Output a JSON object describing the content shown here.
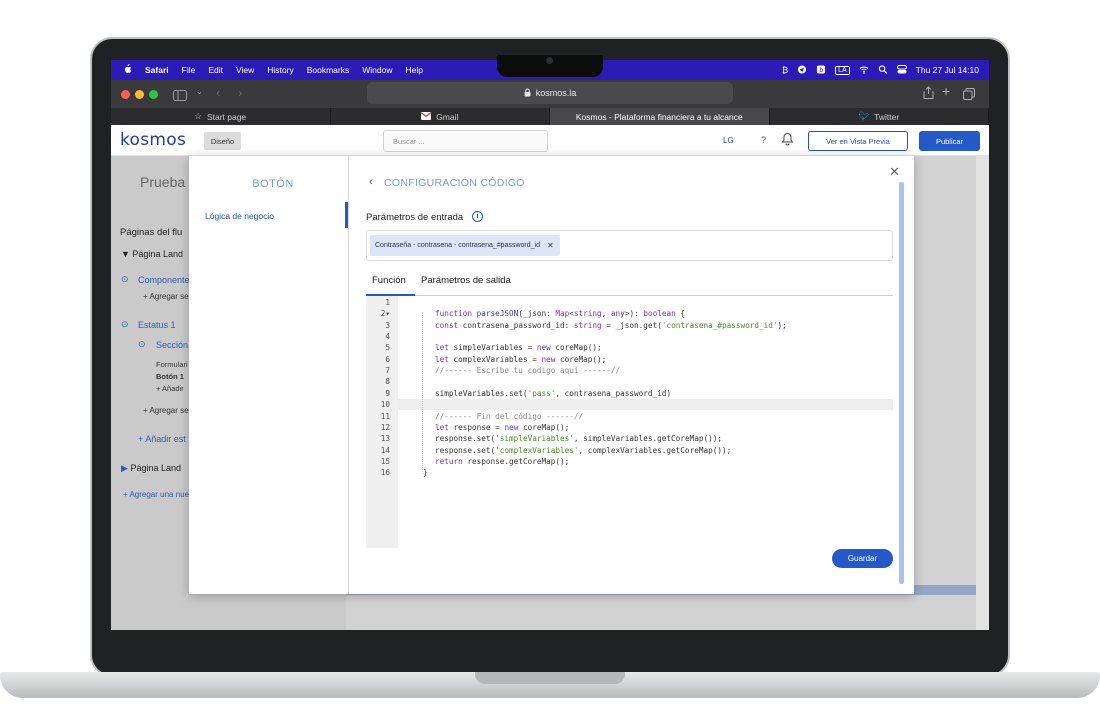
{
  "menubar": {
    "app": "Safari",
    "items": [
      "File",
      "Edit",
      "View",
      "History",
      "Bookmarks",
      "Window",
      "Help"
    ],
    "datetime": "Thu 27 Jul  14:10"
  },
  "browser": {
    "url": "kosmos.la",
    "tabs": [
      {
        "label": "Start page",
        "icon": "star-icon",
        "active": false
      },
      {
        "label": "Gmail",
        "icon": "gmail-icon",
        "active": false
      },
      {
        "label": "Kosmos - Plataforma financiera a tu alcance",
        "icon": "",
        "active": true
      },
      {
        "label": "Twitter",
        "icon": "twitter-icon",
        "active": false
      }
    ]
  },
  "appbar": {
    "logo": "kosmos",
    "mode_button": "Diseño",
    "search_placeholder": "Buscar ...",
    "user_initials": "LG",
    "help": "?",
    "preview_button": "Ver en Vista Previa",
    "publish_button": "Publicar"
  },
  "background": {
    "title": "Prueba",
    "pages_heading": "Páginas del flu",
    "page1": "Página Land",
    "component": "Componente",
    "add_1": "+ Agregar se",
    "status": "Estatus 1",
    "section": "Sección",
    "form": "Formulari",
    "button": "Botón 1",
    "add_sub": "+ Añadir",
    "add_2": "+ Agregar se",
    "add_state": "+ Añadir est",
    "page2": "Página Land",
    "add_new": "+ Agregar una nue"
  },
  "modal": {
    "side_title": "BOTÓN",
    "side_item": "Lógica de negocio",
    "config_title": "CONFIGURACIÓN CÓDIGO",
    "params_label": "Parámetros de entrada",
    "chip_label": "Contraseña - contrasena - contrasena_#password_id",
    "tab_function": "Función",
    "tab_output": "Parámetros de salida",
    "save_button": "Guardar"
  }
}
